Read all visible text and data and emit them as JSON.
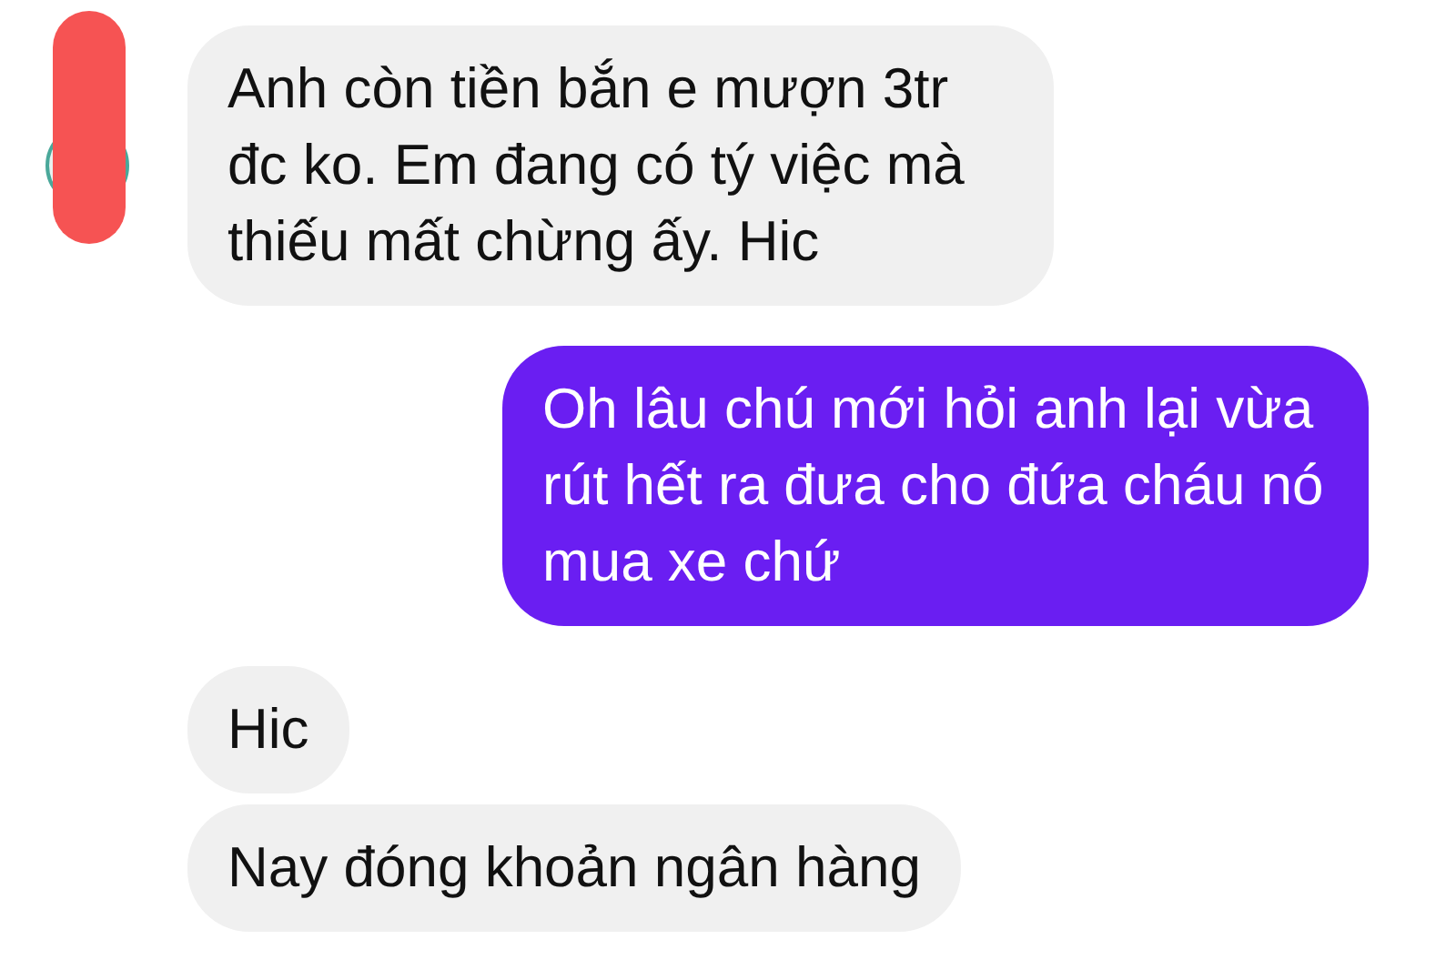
{
  "messages": [
    {
      "kind": "received",
      "text": "Anh còn tiền bắn e mượn 3tr đc ko. Em đang có tý việc mà thiếu mất chừng ấy. Hic",
      "avatar": true
    },
    {
      "kind": "sent",
      "text": "Oh lâu chú mới hỏi anh lại vừa rút hết ra đưa cho đứa cháu nó mua xe chứ"
    },
    {
      "kind": "received",
      "text": "Hic",
      "avatar": false
    },
    {
      "kind": "received",
      "text": "Nay đóng khoản ngân hàng",
      "avatar": false
    }
  ]
}
